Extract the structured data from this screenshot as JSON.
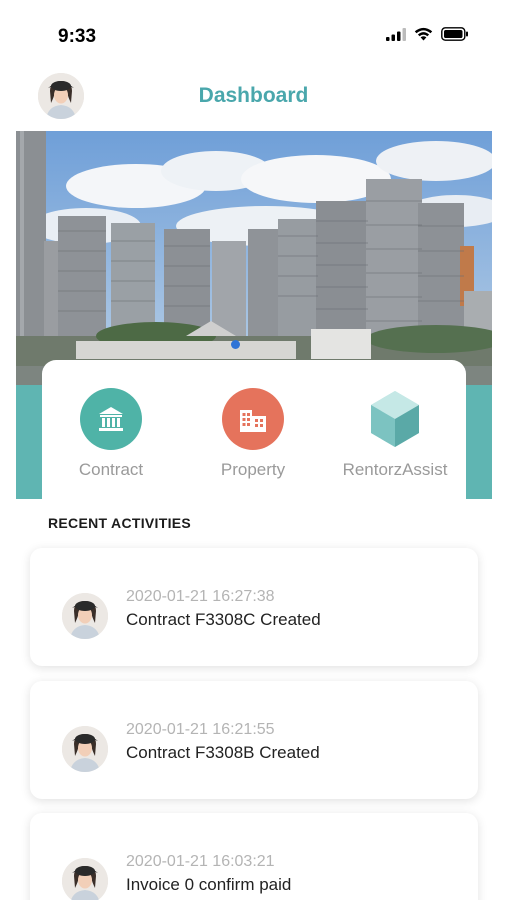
{
  "status_bar": {
    "time": "9:33"
  },
  "header": {
    "title": "Dashboard"
  },
  "quick_actions": [
    {
      "label": "Contract",
      "icon": "bank-icon",
      "color": "#4fb3a7"
    },
    {
      "label": "Property",
      "icon": "buildings-icon",
      "color": "#e5735c"
    },
    {
      "label": "RentorzAssist",
      "icon": "hexagon-icon",
      "color": "#7cc3c1"
    }
  ],
  "activities_title": "RECENT ACTIVITIES",
  "activities": [
    {
      "time": "2020-01-21 16:27:38",
      "text": "Contract F3308C Created"
    },
    {
      "time": "2020-01-21 16:21:55",
      "text": "Contract F3308B Created"
    },
    {
      "time": "2020-01-21 16:03:21",
      "text": "Invoice 0 confirm paid"
    }
  ],
  "colors": {
    "accent": "#4aa7ac",
    "teal_band": "#5fb5b2",
    "carousel_dot": "#2f74d6"
  }
}
